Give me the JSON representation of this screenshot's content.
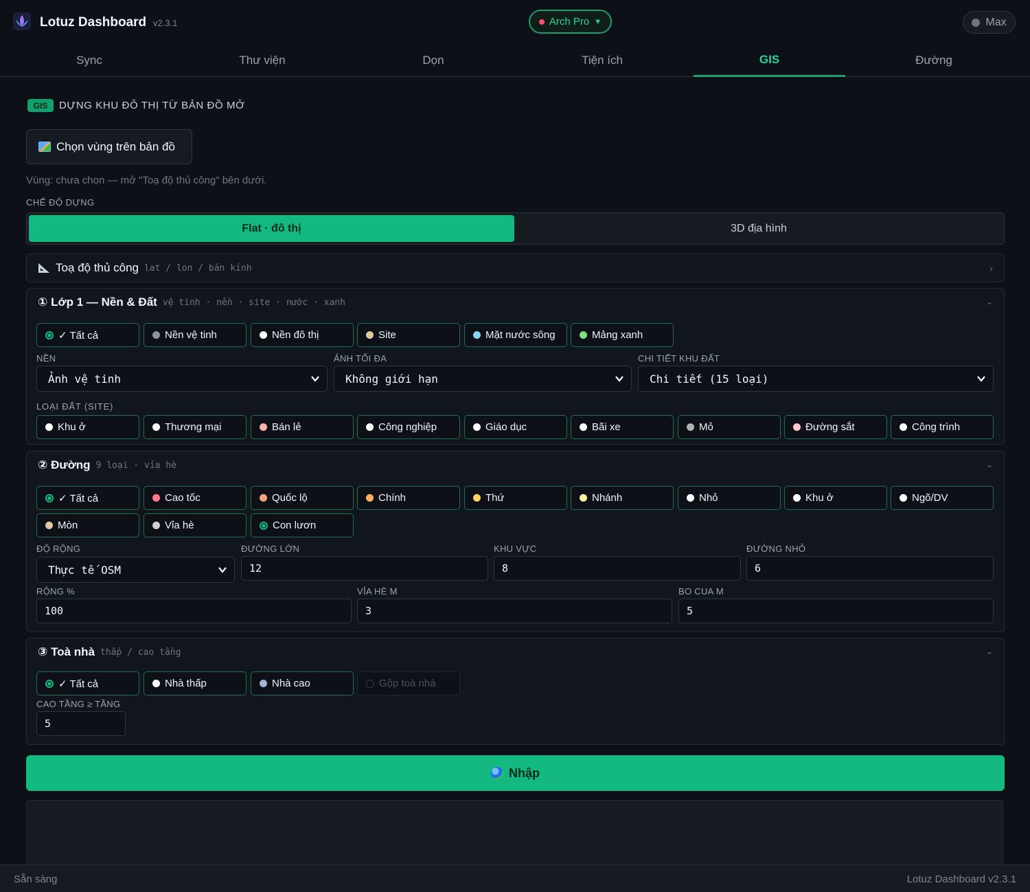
{
  "header": {
    "app_title": "Lotuz Dashboard",
    "version": "v2.3.1",
    "profile": "Arch Pro",
    "profile_caret": "▼",
    "right_toggle": "Max"
  },
  "tabs": [
    "Sync",
    "Thư viện",
    "Dọn",
    "Tiện ích",
    "GIS",
    "Đường"
  ],
  "active_tab": "GIS",
  "section": {
    "badge": "GIS",
    "title": "DỰNG KHU ĐÔ THỊ TỪ BẢN ĐỒ MỞ"
  },
  "pick_button": "Chọn vùng trên bản đồ",
  "zone_hint": "Vùng: chưa chọn — mở \"Toạ độ thủ công\" bên dưới.",
  "mode": {
    "label": "CHẾ ĐỘ DỰNG",
    "options": [
      "Flat · đô thị",
      "3D địa hình"
    ],
    "selected": "Flat · đô thị"
  },
  "manual_coords": {
    "icon": "📐",
    "title": "Toạ độ thủ công",
    "subtitle": "lat / lon / bán kính",
    "chevron": "›"
  },
  "layer1": {
    "title": "① Lớp 1 — Nền & Đất",
    "subtitle": "vệ tinh · nền · site · nước · xanh",
    "chevron": "⌄",
    "chips": [
      {
        "label": "✓ Tất cả",
        "kind": "radio"
      },
      {
        "label": "Nền vệ tinh",
        "color": "#8b949e"
      },
      {
        "label": "Nền đô thị",
        "color": "#ffffff"
      },
      {
        "label": "Site",
        "color": "#e0c9a0"
      },
      {
        "label": "Mặt nước sông",
        "color": "#8fd3f4"
      },
      {
        "label": "Mảng xanh",
        "color": "#7ee07e"
      }
    ],
    "nen": {
      "label": "NỀN",
      "value": "Ảnh vệ tinh"
    },
    "anh_toi_da": {
      "label": "ẢNH TỐI ĐA",
      "value": "Không giới hạn"
    },
    "chi_tiet": {
      "label": "CHI TIẾT KHU ĐẤT",
      "value": "Chi tiết (15 loại)"
    },
    "site_label": "LOẠI ĐẤT (SITE)",
    "site_chips": [
      {
        "label": "Khu ở",
        "color": "#ffffff"
      },
      {
        "label": "Thương mại",
        "color": "#ffffff"
      },
      {
        "label": "Bán lẻ",
        "color": "#ffb3a7"
      },
      {
        "label": "Công nghiệp",
        "color": "#ffffff"
      },
      {
        "label": "Giáo dục",
        "color": "#ffffff"
      },
      {
        "label": "Bãi xe",
        "color": "#ffffff"
      },
      {
        "label": "Mỏ",
        "color": "#b0b0b0"
      },
      {
        "label": "Đường sắt",
        "color": "#ffc9c9"
      },
      {
        "label": "Công trình",
        "color": "#ffffff"
      }
    ]
  },
  "layer2": {
    "title": "② Đường",
    "subtitle": "9 loại · vỉa hè",
    "chevron": "⌄",
    "chips": [
      {
        "label": "✓ Tất cả",
        "kind": "radio"
      },
      {
        "label": "Cao tốc",
        "color": "#ff7b8a"
      },
      {
        "label": "Quốc lộ",
        "color": "#ff9e80"
      },
      {
        "label": "Chính",
        "color": "#ffb066"
      },
      {
        "label": "Thứ",
        "color": "#ffd166"
      },
      {
        "label": "Nhánh",
        "color": "#fff0a0"
      },
      {
        "label": "Nhỏ",
        "color": "#ffffff"
      },
      {
        "label": "Khu ở",
        "color": "#ffffff"
      },
      {
        "label": "Ngõ/DV",
        "color": "#ffffff"
      },
      {
        "label": "Mòn",
        "color": "#e0c9a0"
      },
      {
        "label": "Vỉa hè",
        "color": "#d0d0d0"
      },
      {
        "label": "Con lươn",
        "kind": "radio"
      }
    ],
    "do_rong": {
      "label": "ĐỘ RỘNG",
      "value": "Thực tế OSM"
    },
    "duong_lon": {
      "label": "ĐƯỜNG LỚN",
      "value": "12"
    },
    "khu_vuc": {
      "label": "KHU VỰC",
      "value": "8"
    },
    "duong_nho": {
      "label": "ĐƯỜNG NHỎ",
      "value": "6"
    },
    "rong_pct": {
      "label": "RỘNG %",
      "value": "100"
    },
    "via_he": {
      "label": "VỈA HÈ M",
      "value": "3"
    },
    "bo_cua": {
      "label": "BO CUA M",
      "value": "5"
    }
  },
  "layer3": {
    "title": "③ Toà nhà",
    "subtitle": "thấp / cao tầng",
    "chevron": "⌄",
    "chips": [
      {
        "label": "✓ Tất cả",
        "kind": "radio"
      },
      {
        "label": "Nhà thấp",
        "color": "#ffffff"
      },
      {
        "label": "Nhà cao",
        "color": "#9fb4d8"
      },
      {
        "label": "Gộp toà nhà",
        "kind": "disabled"
      }
    ],
    "cao_tang": {
      "label": "CAO TẦNG ≥ TẦNG",
      "value": "5"
    }
  },
  "import_button": "Nhập",
  "status": {
    "left": "Sẵn sàng",
    "right": "Lotuz Dashboard v2.3.1"
  },
  "colors": {
    "accent": "#14b981",
    "background": "#0d1117",
    "panel": "#11161d",
    "chip_border": "#1f6f52"
  }
}
